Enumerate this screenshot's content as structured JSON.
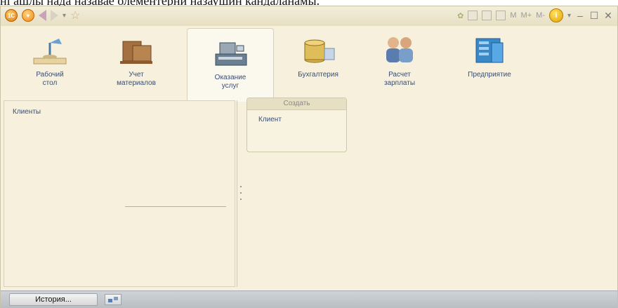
{
  "clipped_text": "ні ашлы нада назавае олементерни назаушин кандаланамы.",
  "toolbar": {
    "logo_label": "1C",
    "memory_labels": [
      "M",
      "M+",
      "M-"
    ],
    "info_label": "i"
  },
  "sections": [
    {
      "label": "Рабочий\nстол",
      "icon": "desk-lamp-icon",
      "active": false
    },
    {
      "label": "Учет\nматериалов",
      "icon": "boxes-icon",
      "active": false
    },
    {
      "label": "Оказание\nуслуг",
      "icon": "cash-register-icon",
      "active": true
    },
    {
      "label": "Бухгалтерия",
      "icon": "coins-icon",
      "active": false
    },
    {
      "label": "Расчет\nзарплаты",
      "icon": "people-icon",
      "active": false
    },
    {
      "label": "Предприятие",
      "icon": "building-icon",
      "active": false
    }
  ],
  "nav_panel": {
    "items": [
      "Клиенты"
    ]
  },
  "create_group": {
    "title": "Создать",
    "items": [
      "Клиент"
    ]
  },
  "statusbar": {
    "history_label": "История..."
  }
}
